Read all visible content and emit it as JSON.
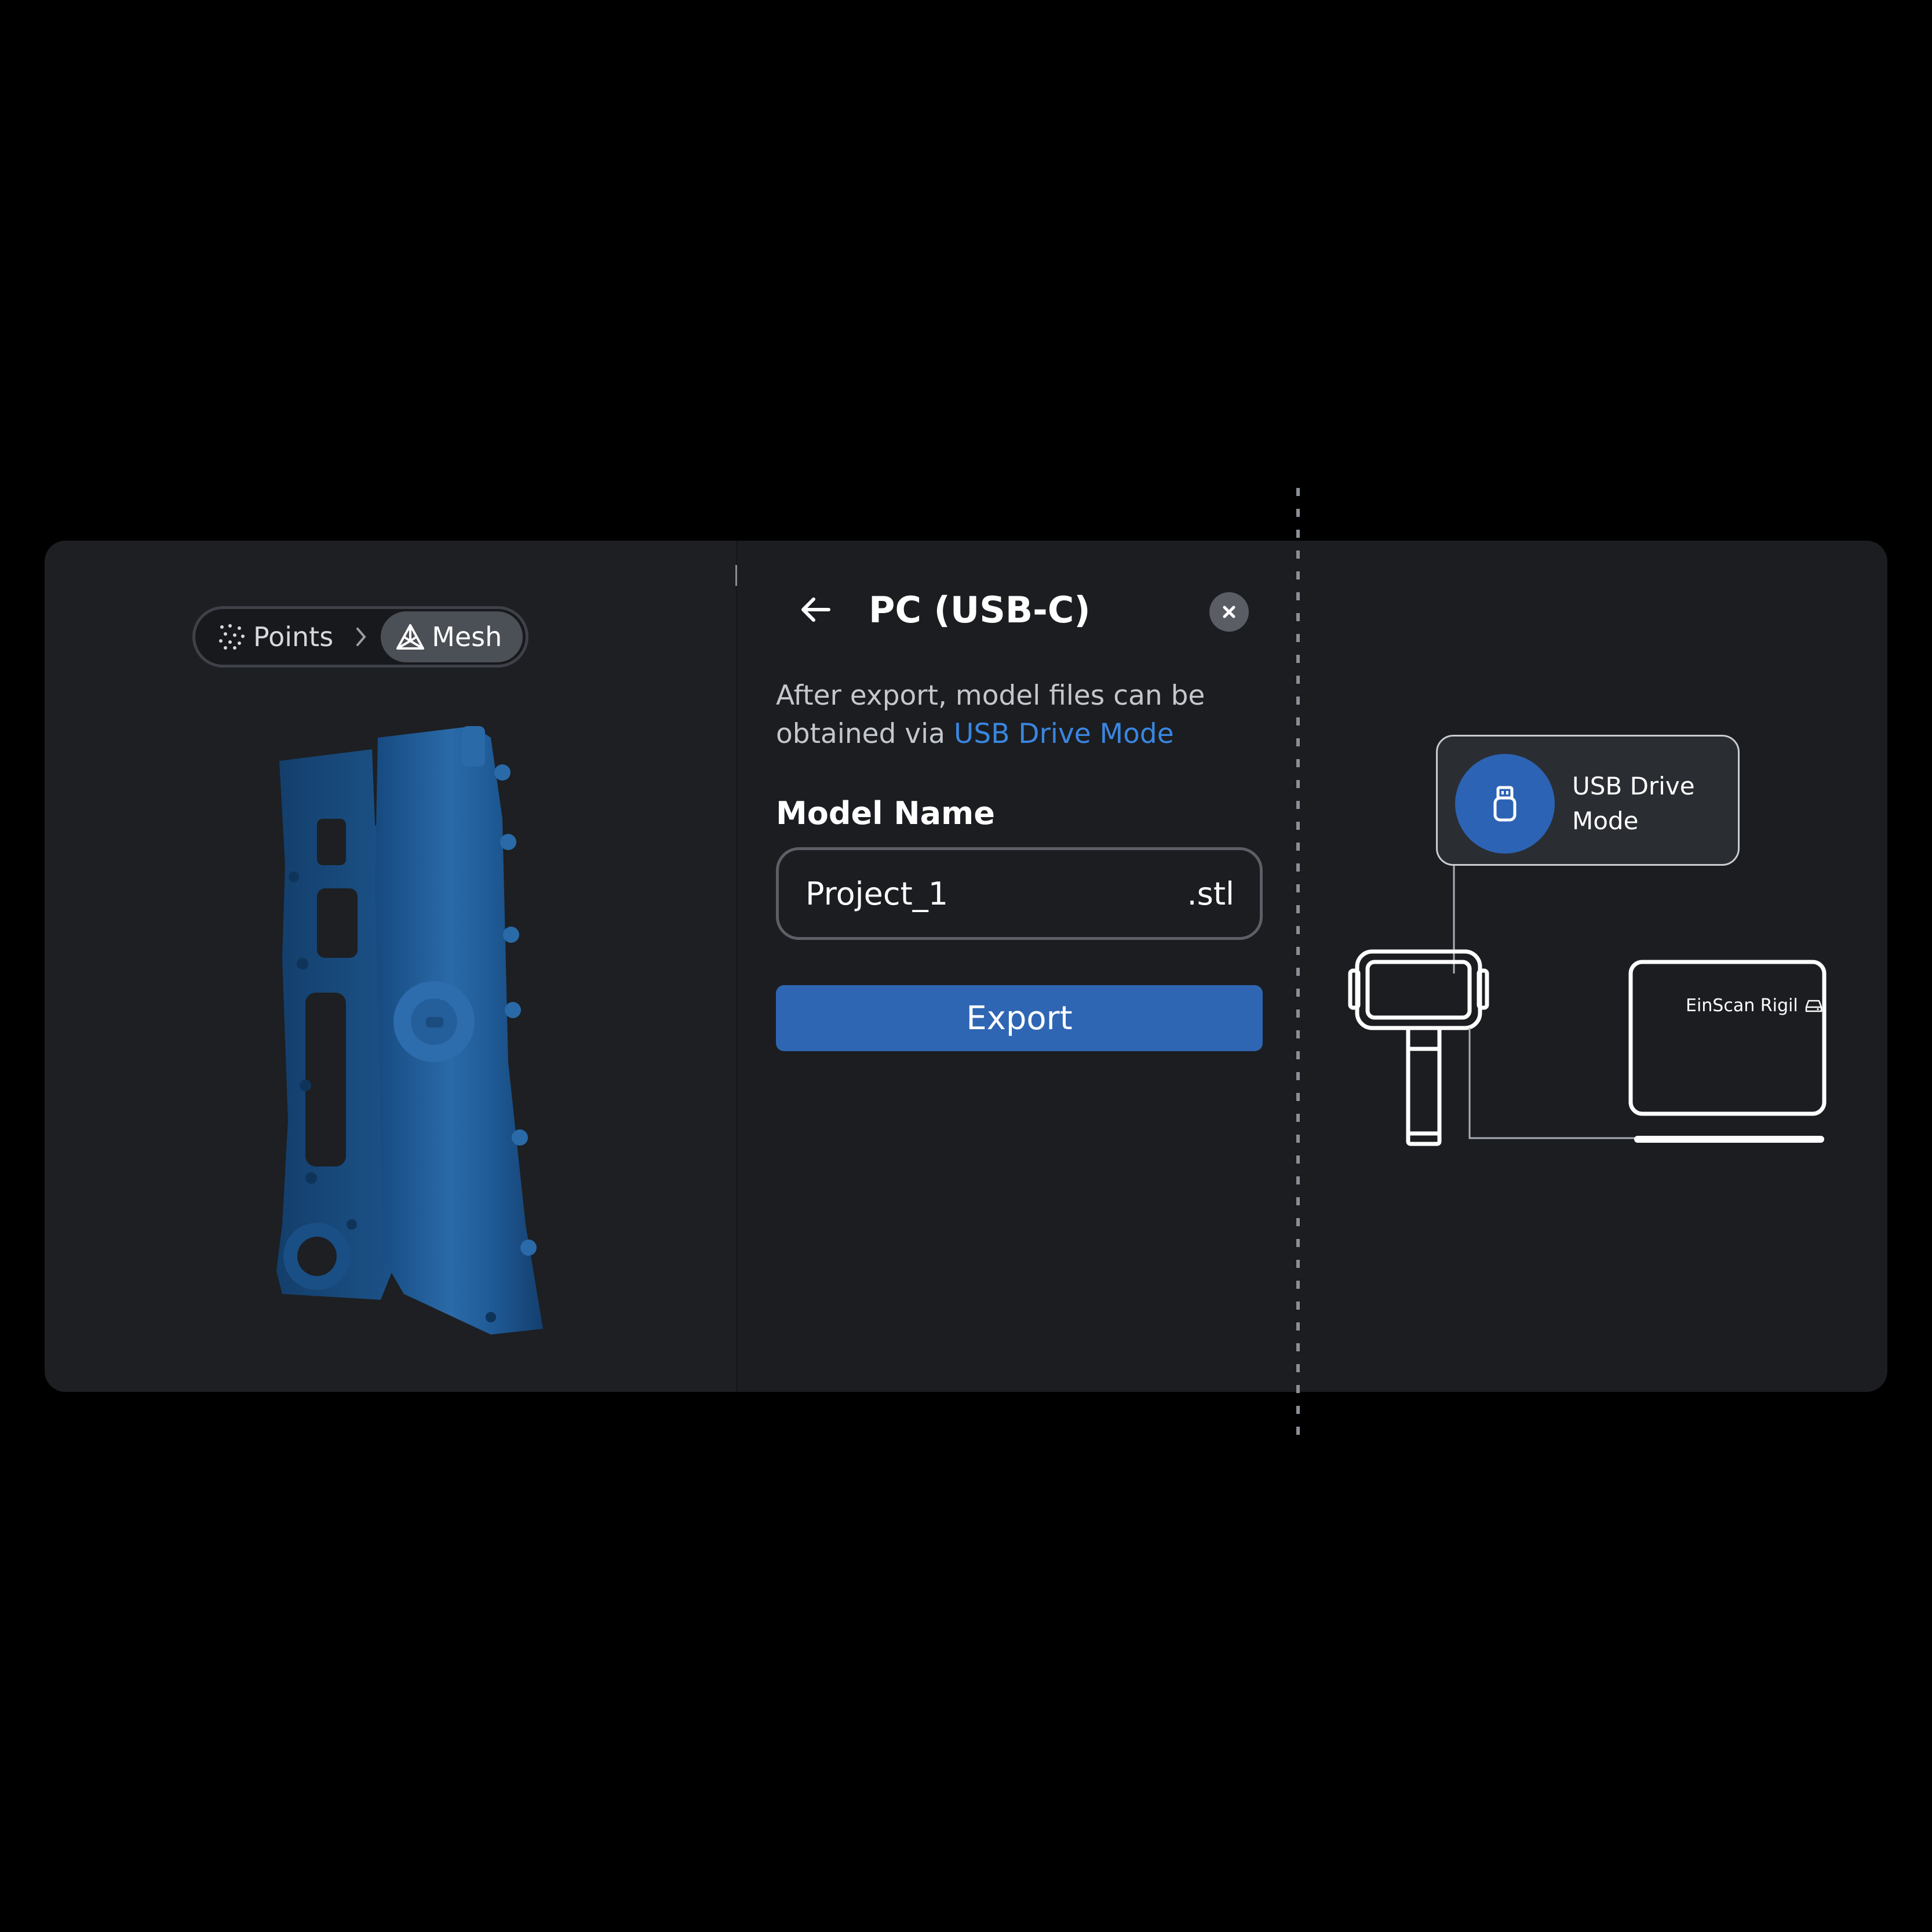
{
  "mode_switch": {
    "points_label": "Points",
    "mesh_label": "Mesh",
    "active": "Mesh"
  },
  "panel": {
    "title": "PC (USB-C)",
    "description_prefix": "After export, model files can be obtained via ",
    "description_link": "USB Drive Mode",
    "model_name_label": "Model Name",
    "model_name_value": "Project_1",
    "extension": ".stl",
    "export_label": "Export"
  },
  "diagram": {
    "usb_mode_label": "USB Drive Mode",
    "laptop_label": "EinScan Rigil"
  },
  "icons": {
    "back": "arrow-left-icon",
    "close": "close-icon",
    "points": "points-icon",
    "mesh": "mesh-icon",
    "usb": "usb-drive-icon",
    "drive": "drive-icon"
  },
  "colors": {
    "accent_blue": "#2f66b3",
    "link_blue": "#3a86e0",
    "card_bg": "#1b1d21",
    "model_blue": "#1f5a96"
  }
}
